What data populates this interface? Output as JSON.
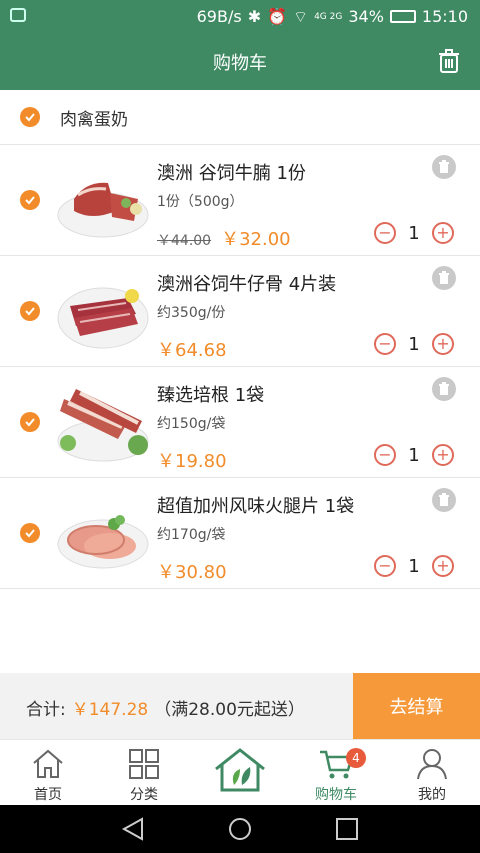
{
  "status_bar": {
    "speed": "69B/s",
    "network": "4G 2G",
    "battery": "34%",
    "time": "15:10"
  },
  "header": {
    "title": "购物车"
  },
  "section": {
    "label": "肉禽蛋奶"
  },
  "items": [
    {
      "name": "澳洲 谷饲牛腩 1份",
      "spec": "1份（500g）",
      "old_price": "￥44.00",
      "price": "￥32.00",
      "qty": "1"
    },
    {
      "name": "澳洲谷饲牛仔骨 4片装",
      "spec": "约350g/份",
      "old_price": "",
      "price": "￥64.68",
      "qty": "1"
    },
    {
      "name": "臻选培根 1袋",
      "spec": "约150g/袋",
      "old_price": "",
      "price": "￥19.80",
      "qty": "1"
    },
    {
      "name": "超值加州风味火腿片 1袋",
      "spec": "约170g/袋",
      "old_price": "",
      "price": "￥30.80",
      "qty": "1"
    }
  ],
  "checkout": {
    "total_label": "合计:",
    "total_amount": "￥147.28",
    "note": "（满28.00元起送）",
    "button": "去结算"
  },
  "tabs": [
    {
      "label": "首页",
      "icon": "home-icon"
    },
    {
      "label": "分类",
      "icon": "grid-icon"
    },
    {
      "label": "",
      "icon": "leaf-house-icon"
    },
    {
      "label": "购物车",
      "icon": "cart-icon",
      "badge": "4"
    },
    {
      "label": "我的",
      "icon": "person-icon"
    }
  ],
  "colors": {
    "brand_green": "#3f8a63",
    "accent_orange": "#f28c2a",
    "checkout_orange": "#f6993b",
    "badge_red": "#e75b3c"
  }
}
